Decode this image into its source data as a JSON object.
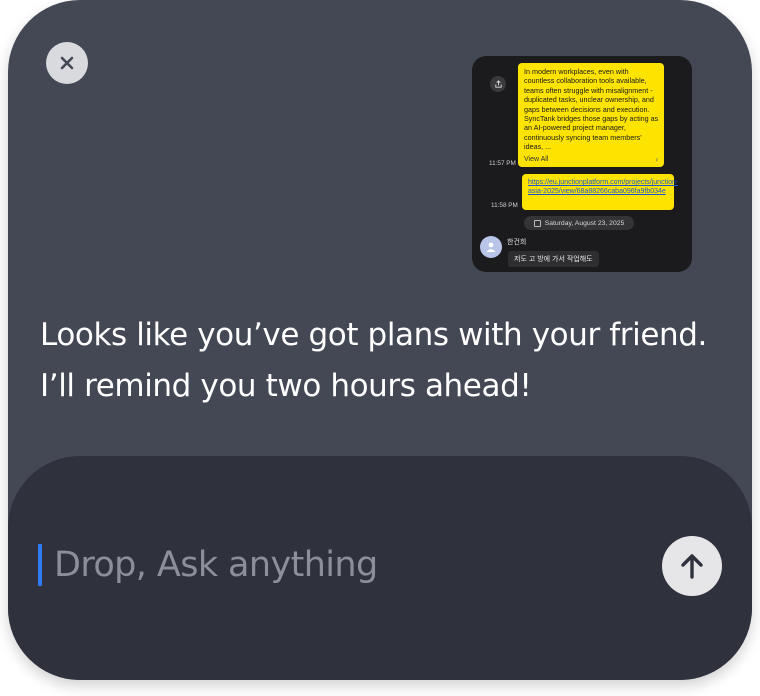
{
  "close": {
    "icon": "close-icon"
  },
  "screenshot_preview": {
    "message1": "In modern workplaces, even with countless collaboration tools available, teams often struggle with misalignment - duplicated tasks, unclear ownership, and gaps between decisions and execution. SyncTank bridges those gaps by acting as an AI-powered project manager, continuously syncing team members' ideas, ...",
    "view_all": "View All",
    "time1": "11:57 PM",
    "link": "https://eu.junctionplatform.com/projects/junction-asia-2025/view/68a88266caba096fa9fb034e",
    "time2": "11:58 PM",
    "date": "Saturday, August 23, 2025",
    "sender": "한건희",
    "message2": "저도 고 방에 가서 작업해도"
  },
  "assistant_message": {
    "line1": "Looks like you’ve got plans with your friend.",
    "line2": "I’ll remind you two hours ahead!"
  },
  "composer": {
    "placeholder": "Drop, Ask anything",
    "value": "",
    "send_icon": "arrow-up-icon"
  },
  "colors": {
    "panel": "#444855",
    "input_area": "#2f323c",
    "caret": "#2f7df6",
    "bubble": "#fde400"
  }
}
